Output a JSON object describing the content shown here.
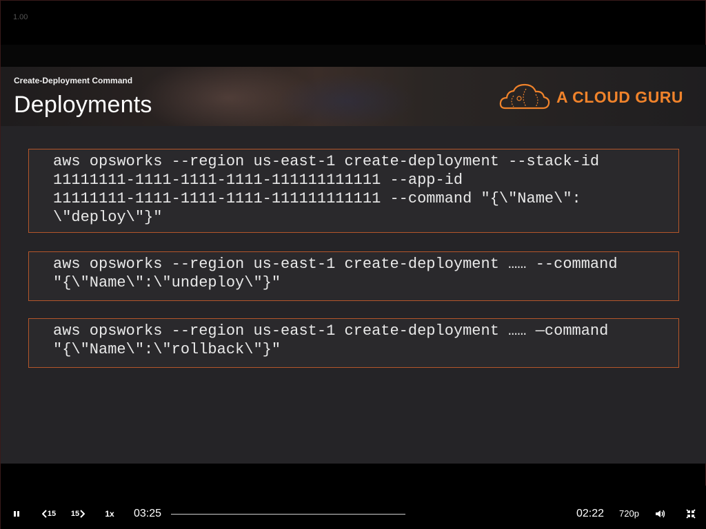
{
  "player": {
    "speed_indicator": "1.00"
  },
  "slide": {
    "subtitle": "Create-Deployment Command",
    "title": "Deployments",
    "brand": {
      "name": "A CLOUD GURU",
      "accent_color": "#f0832b"
    },
    "code_blocks": [
      {
        "lines": [
          "aws opsworks --region us-east-1 create-deployment --stack-id",
          "11111111-1111-1111-1111-111111111111 --app-id",
          "11111111-1111-1111-1111-111111111111 --command \"{\\\"Name\\\":",
          "\\\"deploy\\\"}\""
        ]
      },
      {
        "lines": [
          "aws opsworks --region us-east-1 create-deployment …… --command",
          "\"{\\\"Name\\\":\\\"undeploy\\\"}\""
        ]
      },
      {
        "lines": [
          "aws opsworks --region us-east-1 create-deployment …… —command",
          "\"{\\\"Name\\\":\\\"rollback\\\"}\""
        ]
      }
    ]
  },
  "controls": {
    "pause_icon": "pause-icon",
    "rewind_label": "15",
    "forward_label": "15",
    "speed_label": "1x",
    "elapsed_time": "03:25",
    "remaining_time": "02:22",
    "quality_label": "720p",
    "volume_icon": "volume-icon",
    "exit_fullscreen_icon": "exit-fullscreen-icon"
  }
}
